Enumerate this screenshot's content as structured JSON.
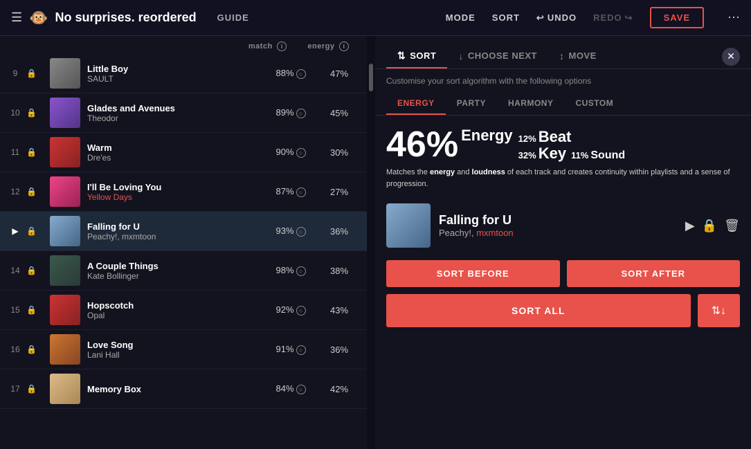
{
  "app": {
    "title": "No surprises. reordered",
    "monkey_icon": "🐵",
    "guide_label": "GUIDE"
  },
  "nav": {
    "mode_label": "MODE",
    "sort_label": "SORT",
    "undo_label": "UNDO",
    "redo_label": "REDO",
    "save_label": "SAVE",
    "more_icon": "⋯"
  },
  "playlist": {
    "match_header": "match",
    "energy_header": "energy",
    "tracks": [
      {
        "num": "9",
        "playing": false,
        "locked": true,
        "title": "Little Boy",
        "artist": "SAULT",
        "artist_highlight": false,
        "match": "88%",
        "energy": "47%",
        "thumb": "thumb-gray"
      },
      {
        "num": "10",
        "playing": false,
        "locked": true,
        "title": "Glades and Avenues",
        "artist": "Theodor",
        "artist_highlight": false,
        "match": "89%",
        "energy": "45%",
        "thumb": "thumb-purple"
      },
      {
        "num": "11",
        "playing": false,
        "locked": true,
        "title": "Warm",
        "artist": "Dre'es",
        "artist_highlight": false,
        "match": "90%",
        "energy": "30%",
        "thumb": "thumb-red"
      },
      {
        "num": "12",
        "playing": false,
        "locked": true,
        "title": "I'll Be Loving You",
        "artist": "Yellow Days",
        "artist_highlight": true,
        "match": "87%",
        "energy": "27%",
        "thumb": "thumb-pink"
      },
      {
        "num": "▶",
        "playing": true,
        "locked": true,
        "title": "Falling for U",
        "artist": "Peachy!, mxmtoon",
        "artist_highlight": false,
        "match": "93%",
        "energy": "36%",
        "thumb": "thumb-sky",
        "active": true
      },
      {
        "num": "14",
        "playing": false,
        "locked": true,
        "title": "A Couple Things",
        "artist": "Kate Bollinger",
        "artist_highlight": false,
        "match": "98%",
        "energy": "38%",
        "thumb": "thumb-dark"
      },
      {
        "num": "15",
        "playing": false,
        "locked": true,
        "title": "Hopscotch",
        "artist": "Opal",
        "artist_highlight": false,
        "match": "92%",
        "energy": "43%",
        "thumb": "thumb-red"
      },
      {
        "num": "16",
        "playing": false,
        "locked": true,
        "title": "Love Song",
        "artist": "Lani Hall",
        "artist_highlight": false,
        "match": "91%",
        "energy": "36%",
        "thumb": "thumb-warm"
      },
      {
        "num": "17",
        "playing": false,
        "locked": true,
        "title": "Memory Box",
        "artist": "",
        "artist_highlight": false,
        "match": "84%",
        "energy": "42%",
        "thumb": "thumb-cream"
      }
    ]
  },
  "sort_panel": {
    "tabs": [
      {
        "label": "SORT",
        "icon": "⇅",
        "active": true
      },
      {
        "label": "CHOOSE NEXT",
        "icon": "↓",
        "active": false
      },
      {
        "label": "MOVE",
        "icon": "↕",
        "active": false
      }
    ],
    "subtitle": "Customise your sort algorithm with the following options",
    "algo_tabs": [
      {
        "label": "ENERGY",
        "active": true
      },
      {
        "label": "PARTY",
        "active": false
      },
      {
        "label": "HARMONY",
        "active": false
      },
      {
        "label": "CUSTOM",
        "active": false
      }
    ],
    "energy": {
      "big_pct": "46%",
      "big_label": "Energy",
      "beat_pct": "12%",
      "beat_label": "Beat",
      "key_pct": "32%",
      "key_label": "Key",
      "sound_pct": "11%",
      "sound_label": "Sound",
      "description_html": "Matches the energy and loudness of each track and creates continuity within playlists and a sense of progression."
    },
    "selected_track": {
      "title": "Falling for U",
      "artist_part1": "Peachy!, ",
      "artist_part2": "mxmtoon",
      "thumb": "thumb-sky"
    },
    "sort_before_label": "SORT BEFORE",
    "sort_after_label": "SORT AFTER",
    "sort_all_label": "SORT ALL",
    "sort_options_icon": "⇅"
  }
}
